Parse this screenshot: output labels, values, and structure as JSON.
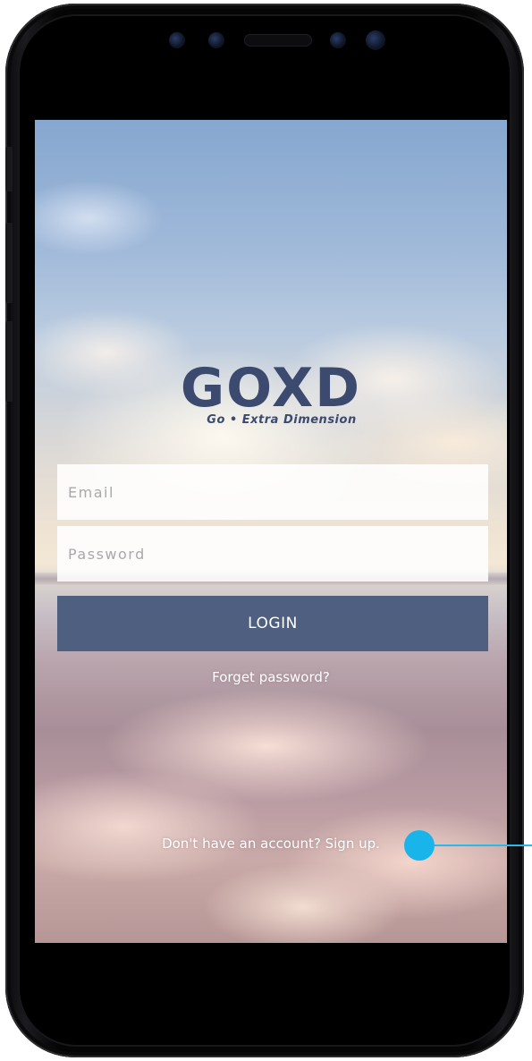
{
  "brand": {
    "logo_text": "GOXD",
    "tagline": "Go • Extra Dimension"
  },
  "login_form": {
    "email_placeholder": "Email",
    "password_placeholder": "Password",
    "login_label": "LOGIN",
    "forget_password_label": "Forget password?"
  },
  "footer": {
    "signup_label": "Don't have an account? Sign up."
  },
  "colors": {
    "brand_navy": "#3b4a6e",
    "login_button": "#4f5f7f",
    "hotspot_accent": "#19b5ea"
  },
  "icons": {
    "annotation_marker": "filled-circle"
  }
}
